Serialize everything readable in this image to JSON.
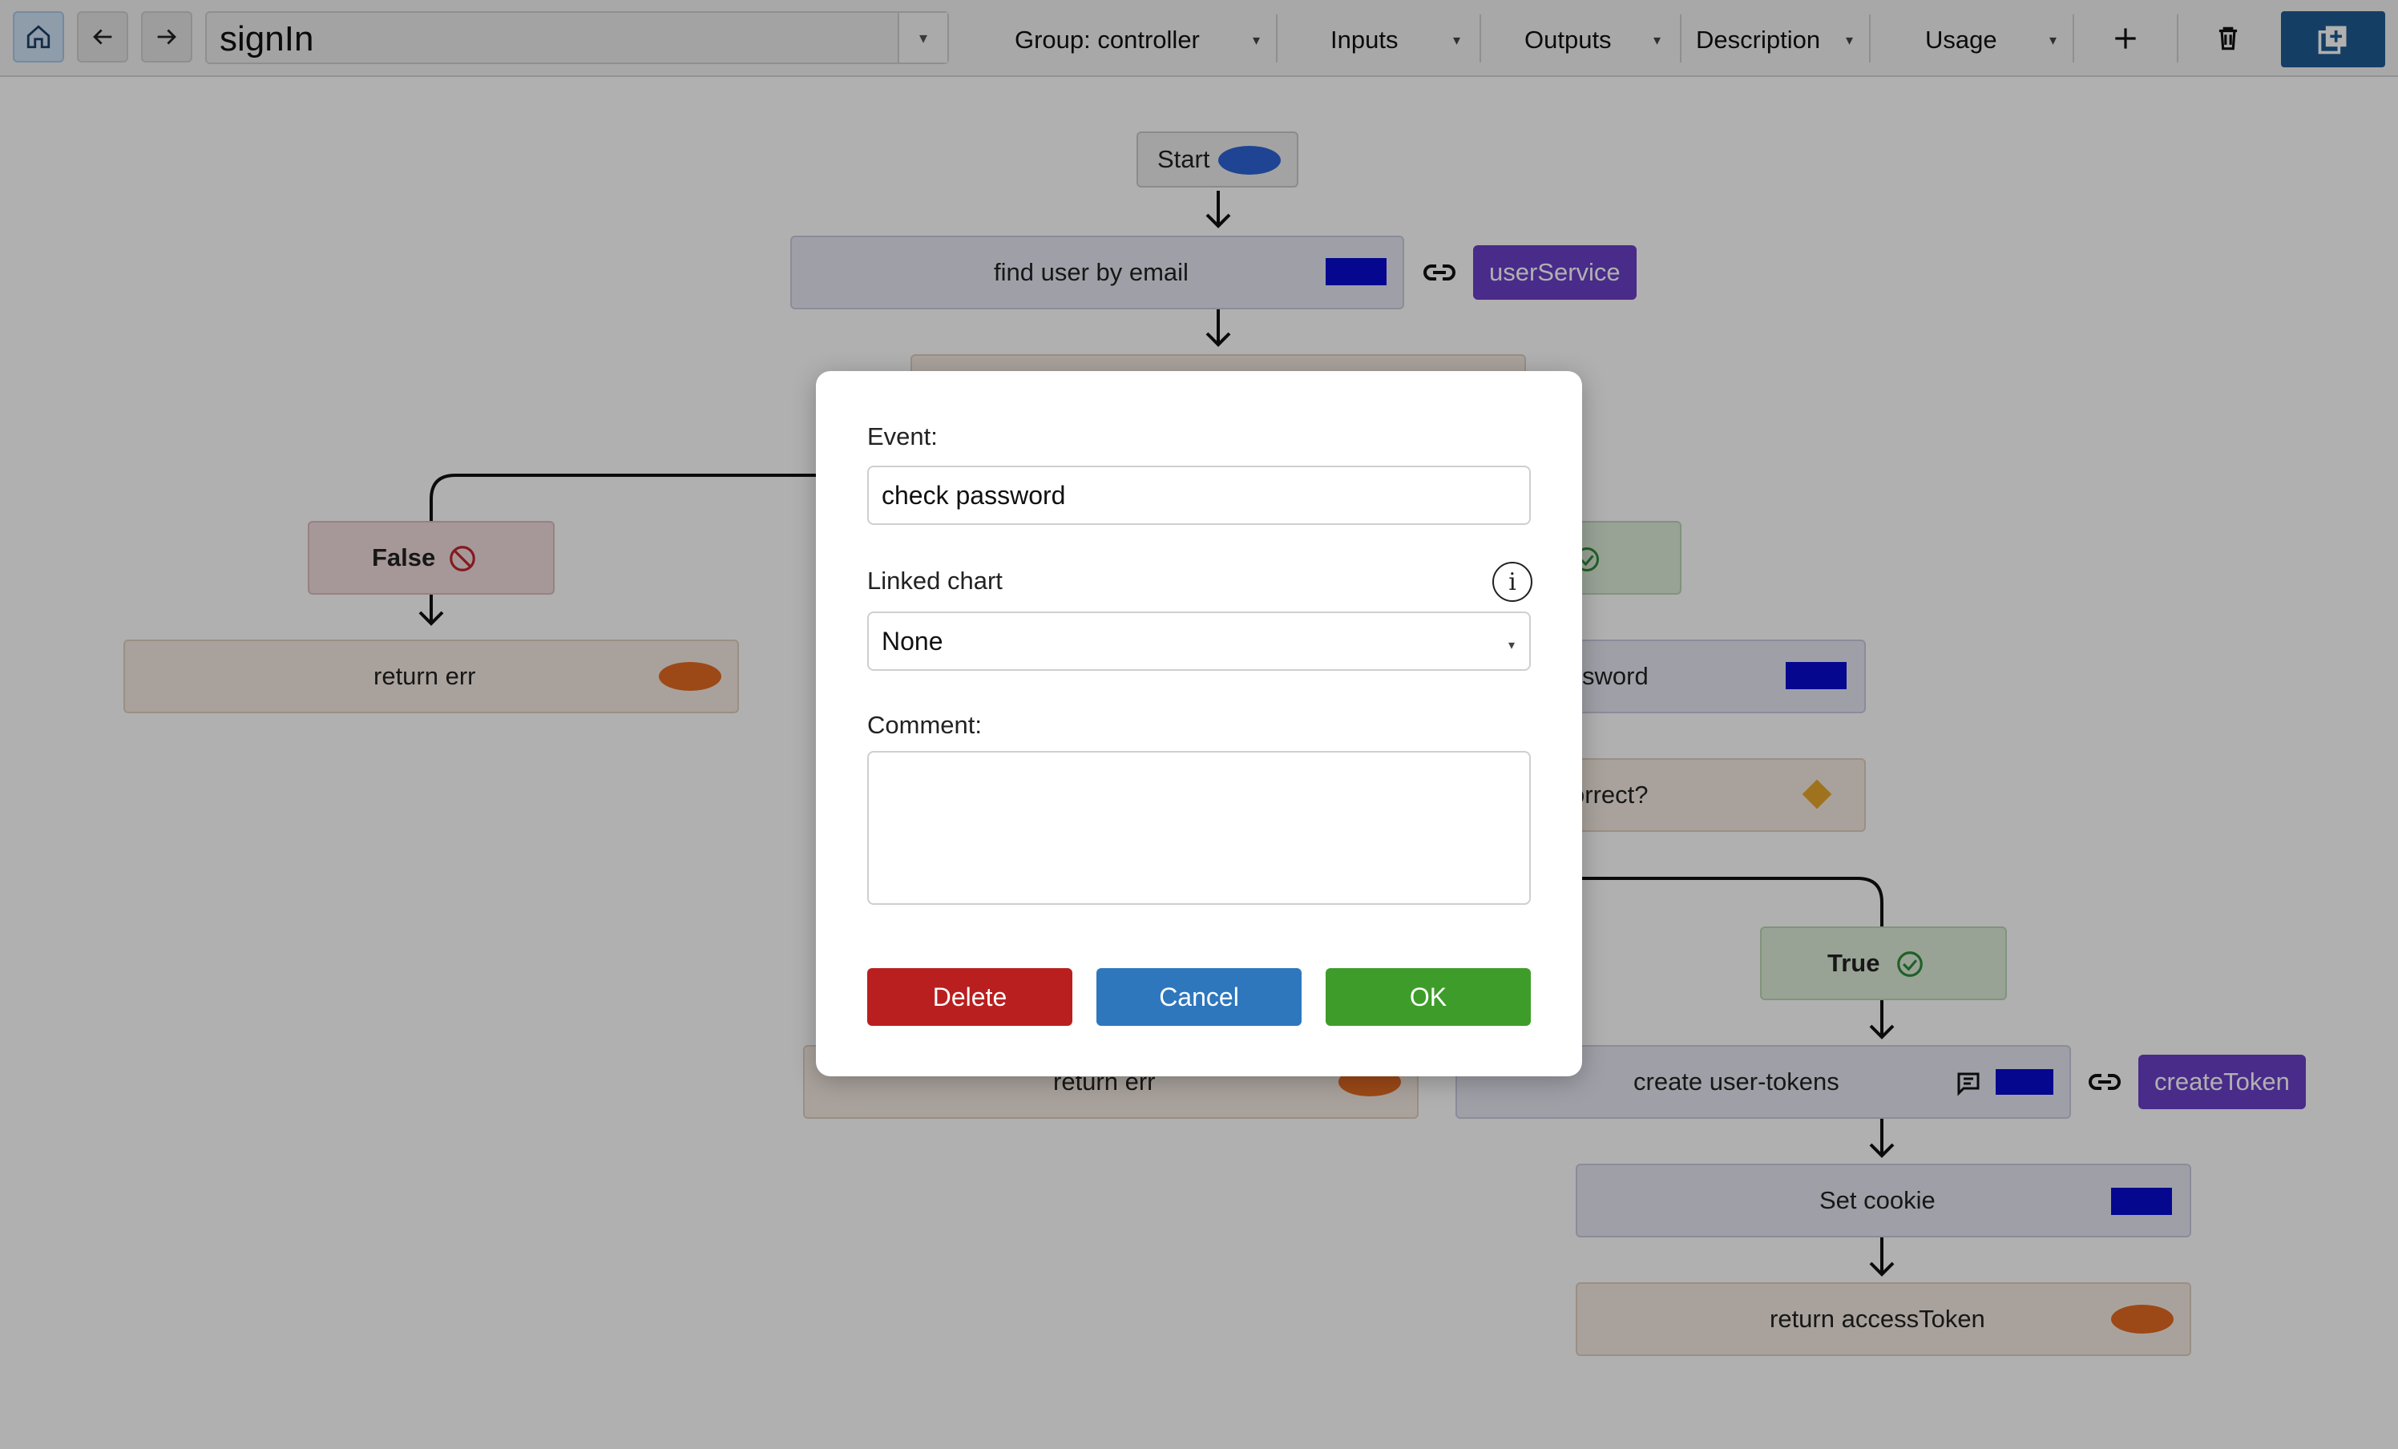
{
  "toolbar": {
    "chart_name": "signIn",
    "menus": {
      "group": "Group: controller",
      "inputs": "Inputs",
      "outputs": "Outputs",
      "description": "Description",
      "usage": "Usage"
    },
    "caret": "▾"
  },
  "canvas": {
    "start": "Start",
    "find_user": "find user by email",
    "user_service": "userService",
    "false_label": "False",
    "return_err_left": "return err",
    "true_label_partial": "",
    "password_partial": "sword",
    "correct_partial": "orrect?",
    "true_label": "True",
    "return_err_mid": "return err",
    "create_tokens": "create user-tokens",
    "create_token_service": "createToken",
    "set_cookie": "Set cookie",
    "return_access": "return accessToken"
  },
  "dialog": {
    "event_label": "Event:",
    "event_value": "check password",
    "linked_chart_label": "Linked chart",
    "linked_chart_value": "None",
    "info_glyph": "i",
    "comment_label": "Comment:",
    "delete": "Delete",
    "cancel": "Cancel",
    "ok": "OK"
  },
  "colors": {
    "action_marker": "#0a0bd0",
    "end_marker": "#e26a22",
    "start_marker": "#2e63d6",
    "service_tag": "#6a3fc8",
    "delete_btn": "#b91f1f",
    "cancel_btn": "#2e77bd",
    "ok_btn": "#3e9d2a"
  }
}
